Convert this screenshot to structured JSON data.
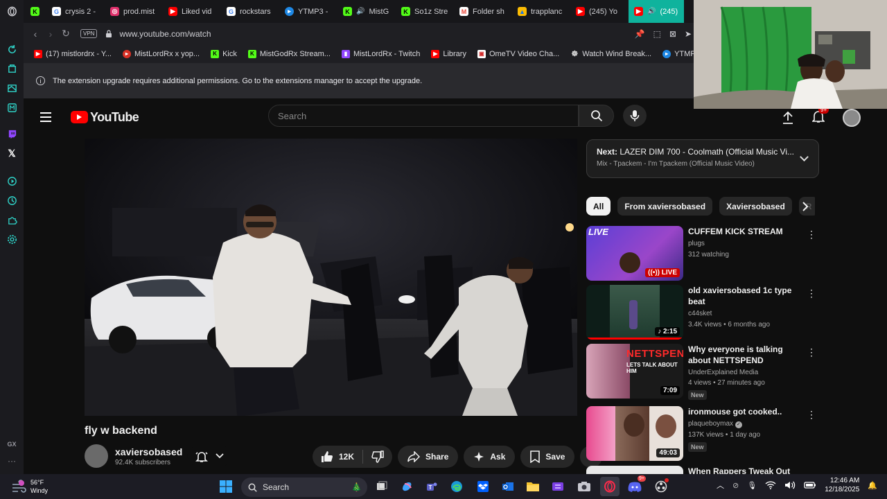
{
  "browser": {
    "tabs": [
      {
        "label": "crysis 2 -",
        "icon": "google"
      },
      {
        "label": "prod.mist",
        "icon": "instagram"
      },
      {
        "label": "Liked vid",
        "icon": "youtube"
      },
      {
        "label": "rockstars",
        "icon": "google"
      },
      {
        "label": "YTMP3 -",
        "icon": "ytmp3"
      },
      {
        "label": "MistG",
        "icon": "kick",
        "audio": true
      },
      {
        "label": "So1z Stre",
        "icon": "kick"
      },
      {
        "label": "Folder sh",
        "icon": "gmail"
      },
      {
        "label": "trapplanc",
        "icon": "drive"
      },
      {
        "label": "(245) Yo",
        "icon": "youtube"
      },
      {
        "label": "(245)",
        "icon": "youtube",
        "audio": true,
        "active": true
      }
    ],
    "vpn_label": "VPN",
    "url": "www.youtube.com/watch",
    "bookmarks": [
      {
        "label": "(17) mistlordrx - Y...",
        "icon": "youtube"
      },
      {
        "label": "MistLordRx x yop...",
        "icon": "ytmp3"
      },
      {
        "label": "Kick",
        "icon": "kick"
      },
      {
        "label": "MistGodRx Stream...",
        "icon": "kick"
      },
      {
        "label": "MistLordRx - Twitch",
        "icon": "twitch"
      },
      {
        "label": "Library",
        "icon": "youtube"
      },
      {
        "label": "OmeTV Video Cha...",
        "icon": "ometv"
      },
      {
        "label": "Watch Wind Break...",
        "icon": "wind"
      },
      {
        "label": "YTMP3 - Y",
        "icon": "ytmp3"
      }
    ],
    "notice": "The extension upgrade requires additional permissions. Go to the extensions manager to accept the upgrade.",
    "rail_bottom": "GX"
  },
  "youtube": {
    "logo_text": "YouTube",
    "search_placeholder": "Search",
    "notification_count": "9+",
    "video": {
      "title": "fly w backend",
      "channel": "xaviersobased",
      "subscribers": "92.4K subscribers",
      "likes": "12K",
      "share_label": "Share",
      "ask_label": "Ask",
      "save_label": "Save"
    },
    "up_next": {
      "prefix": "Next:",
      "title": "LAZER DIM 700 - Coolmath (Official Music Vi...",
      "subtitle": "Mix - Tpackem - I'm Tpackem (Official Music Video)"
    },
    "chips": [
      "All",
      "From xaviersobased",
      "Xaviersobased",
      "R"
    ],
    "recommendations": [
      {
        "title": "CUFFEM KICK STREAM",
        "channel": "plugs",
        "stats": "312 watching",
        "badge": "LIVE",
        "live": true,
        "thumb_text": "LIVE"
      },
      {
        "title": "old xaviersobased 1c type beat",
        "channel": "c44sket",
        "stats": "3.4K views • 6 months ago",
        "badge": "2:15"
      },
      {
        "title": "Why everyone is talking about NETTSPEND (Underground ...",
        "channel": "UnderExplained Media",
        "stats": "4 views • 27 minutes ago",
        "badge": "7:09",
        "new": "New",
        "thumb_text": "NETTSPEND",
        "thumb_sub": "LETS TALK ABOUT HIM"
      },
      {
        "title": "ironmouse got cooked..",
        "channel": "plaqueboymax",
        "stats": "137K views • 1 day ago",
        "badge": "49:03",
        "new": "New",
        "verified": true
      },
      {
        "title": "When Rappers Tweak Out",
        "channel": "",
        "stats": "",
        "badge": ""
      }
    ]
  },
  "taskbar": {
    "temperature": "56°F",
    "condition": "Windy",
    "search_label": "Search",
    "time": "12:46 AM",
    "date": "12/18/2025",
    "discord_badge": "9+"
  }
}
